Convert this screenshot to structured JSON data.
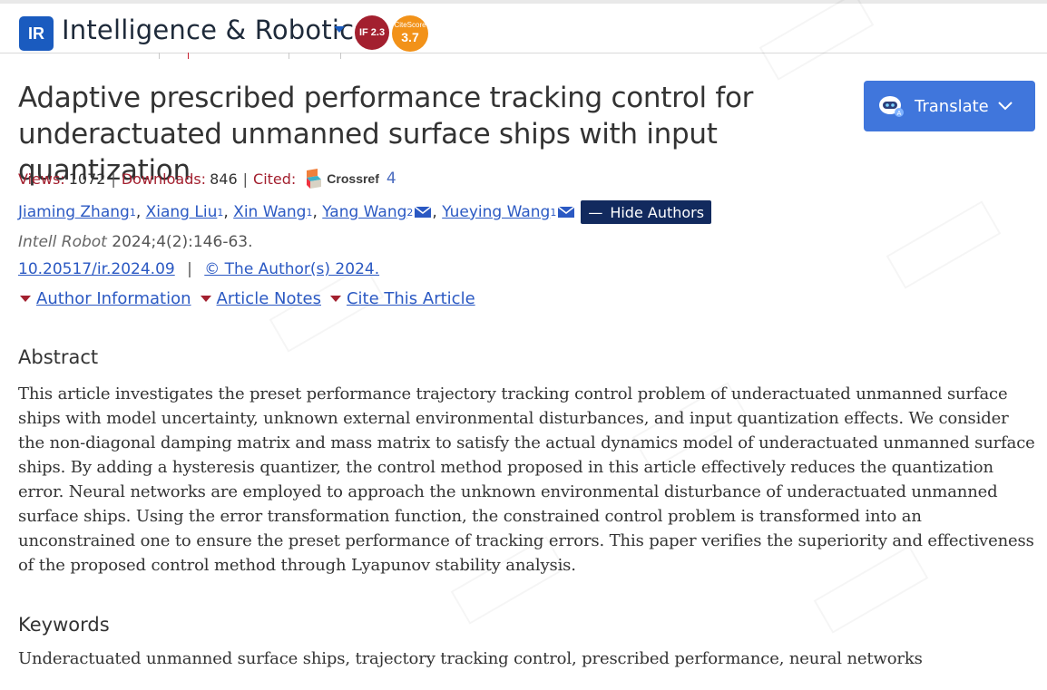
{
  "header": {
    "logo_text": "IR",
    "journal_name": "Intelligence & Robotics",
    "impact_factor": "IF 2.3",
    "citescore_label": "CiteScore",
    "citescore_value": "3.7"
  },
  "article": {
    "title": "Adaptive prescribed performance tracking control for underactuated unmanned surface ships with input quantization",
    "metrics": {
      "views_label": "Views:",
      "views": "1072",
      "downloads_label": "Downloads:",
      "downloads": "846",
      "cited_label": "Cited:",
      "crossref_label": "Crossref",
      "cited_count": "4"
    },
    "authors": [
      {
        "name": "Jiaming Zhang",
        "sup": "1"
      },
      {
        "name": "Xiang Liu",
        "sup": "1"
      },
      {
        "name": "Xin Wang",
        "sup": "1"
      },
      {
        "name": "Yang Wang",
        "sup": "2"
      },
      {
        "name": "Yueying Wang",
        "sup": "1"
      }
    ],
    "hide_authors_label": "Hide Authors",
    "journal_abbrev": "Intell Robot",
    "citation": "2024;4(2):146-63.",
    "doi": "10.20517/ir.2024.09",
    "license": "© The Author(s) 2024."
  },
  "tabs": [
    {
      "label": "Author Information"
    },
    {
      "label": "Article Notes"
    },
    {
      "label": "Cite This Article"
    }
  ],
  "translate": {
    "label": "Translate"
  },
  "abstract": {
    "heading": "Abstract",
    "text": "This article investigates the preset performance trajectory tracking control problem of underactuated unmanned surface ships with model uncertainty, unknown external environmental disturbances, and input quantization effects. We consider the non-diagonal damping matrix and mass matrix to satisfy the actual dynamics model of underactuated unmanned surface ships. By adding a hysteresis quantizer, the control method proposed in this article effectively reduces the quantization error. Neural networks are employed to approach the unknown environmental disturbance of underactuated unmanned surface ships. Using the error transformation function, the constrained control problem is transformed into an unconstrained one to ensure the preset performance of tracking errors. This paper verifies the superiority and effectiveness of the proposed control method through Lyapunov stability analysis."
  },
  "keywords": {
    "heading": "Keywords",
    "text": "Underactuated unmanned surface ships, trajectory tracking control, prescribed performance, neural networks"
  },
  "colors": {
    "brand_blue": "#1a5bbf",
    "link_blue": "#2b59c3",
    "accent_red": "#a3202f",
    "citescore_orange": "#f29219",
    "translate_button": "#4076dc",
    "hide_authors_bg": "#122a5e"
  }
}
